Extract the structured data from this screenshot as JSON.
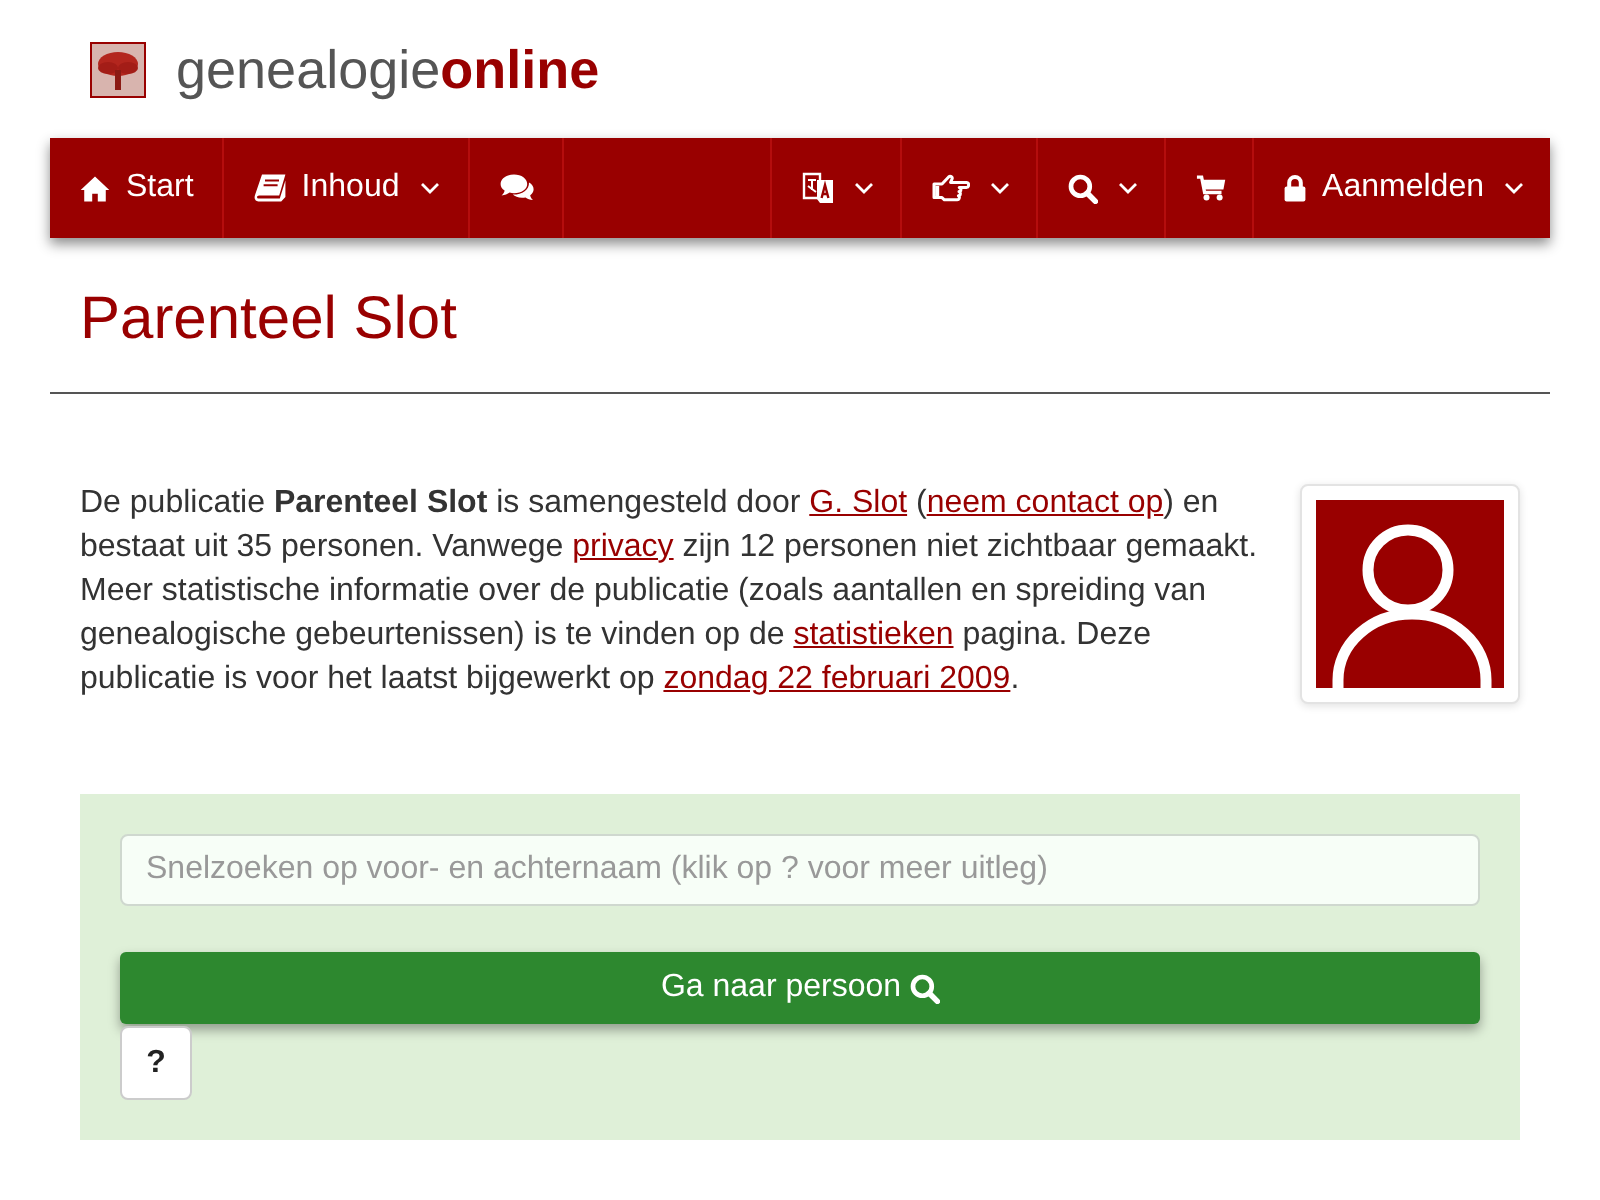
{
  "logo": {
    "text": "genealogie**online**"
  },
  "navbar": {
    "left": [
      {
        "label": "Start",
        "dropdown": false
      },
      {
        "label": "Inhoud",
        "dropdown": true
      },
      {
        "dropdown": false
      }
    ],
    "right": [
      {
        "dropdown": true
      },
      {
        "dropdown": true
      },
      {
        "dropdown": true
      },
      {
        "dropdown": false
      },
      {
        "label": "Aanmelden",
        "dropdown": true
      }
    ]
  },
  "page_title": "Parenteel Slot",
  "intro": [
    {
      "kind": "text",
      "text": "De publicatie **Parenteel Slot** is samengesteld door "
    },
    {
      "kind": "link",
      "text": "G. Slot"
    },
    {
      "kind": "text",
      "text": " ("
    },
    {
      "kind": "link",
      "text": "neem contact op"
    },
    {
      "kind": "text",
      "text": ") en bestaat uit 35 personen. Vanwege "
    },
    {
      "kind": "link",
      "text": "privacy"
    },
    {
      "kind": "text",
      "text": " zijn 12 personen niet zichtbaar gemaakt. Meer statistische informatie over de publicatie (zoals aantallen en spreiding van genealogische gebeurtenissen) is te vinden op de "
    },
    {
      "kind": "link",
      "text": "statistieken"
    },
    {
      "kind": "text",
      "text": " pagina. Deze publicatie is voor het laatst bijgewerkt op "
    },
    {
      "kind": "link",
      "text": "zondag 22 februari 2009"
    },
    {
      "kind": "text",
      "text": "."
    }
  ],
  "quick_search": {
    "placeholder": "Snelzoeken op voor- en achternaam (klik op ? voor meer uitleg)",
    "submit_label": "Ga naar persoon",
    "help_label": "?"
  }
}
